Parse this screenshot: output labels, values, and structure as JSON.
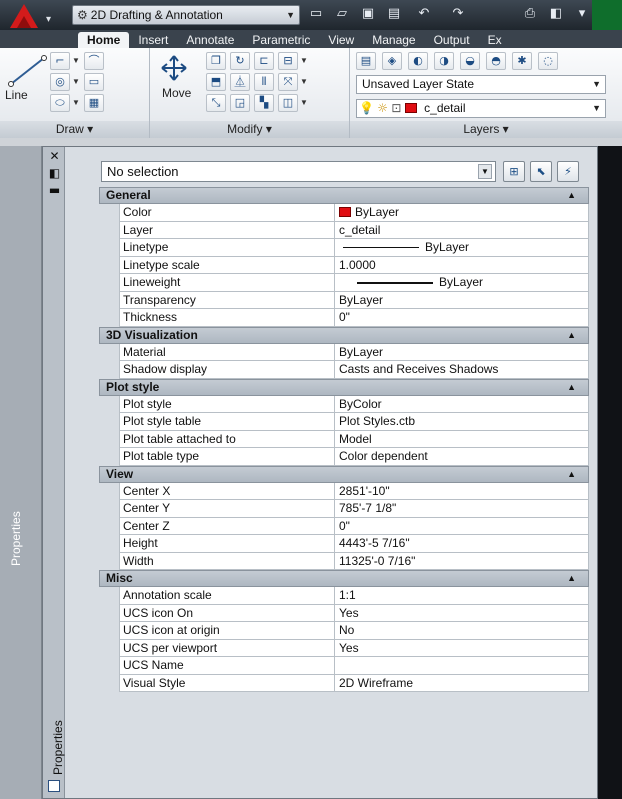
{
  "titlebar": {
    "workspace": "2D Drafting & Annotation",
    "quick_access": [
      "new-icon",
      "open-icon",
      "save-icon",
      "saveas-icon",
      "undo-icon",
      "redo-icon",
      "plot-icon",
      "share-icon"
    ]
  },
  "ribbon": {
    "tabs": [
      "Home",
      "Insert",
      "Annotate",
      "Parametric",
      "View",
      "Manage",
      "Output",
      "Ex"
    ],
    "active_tab": "Home",
    "draw": {
      "title": "Draw ▾",
      "line_label": "Line"
    },
    "modify": {
      "title": "Modify ▾",
      "move_label": "Move"
    },
    "layers": {
      "title": "Layers ▾",
      "layer_state": "Unsaved Layer State",
      "current_layer": "c_detail",
      "layer_color": "#e00d12"
    }
  },
  "palette": {
    "side_title": "Properties",
    "strip_title": "Properties",
    "selection": "No selection",
    "categories": [
      {
        "name": "General",
        "rows": [
          {
            "name": "Color",
            "value": "ByLayer",
            "swatch": "#e00d12"
          },
          {
            "name": "Layer",
            "value": "c_detail"
          },
          {
            "name": "Linetype",
            "value": "ByLayer",
            "line": "thin"
          },
          {
            "name": "Linetype scale",
            "value": "1.0000"
          },
          {
            "name": "Lineweight",
            "value": "ByLayer",
            "line": "thick"
          },
          {
            "name": "Transparency",
            "value": "ByLayer"
          },
          {
            "name": "Thickness",
            "value": "0\""
          }
        ]
      },
      {
        "name": "3D Visualization",
        "rows": [
          {
            "name": "Material",
            "value": "ByLayer"
          },
          {
            "name": "Shadow display",
            "value": "Casts and Receives Shadows"
          }
        ]
      },
      {
        "name": "Plot style",
        "rows": [
          {
            "name": "Plot style",
            "value": "ByColor"
          },
          {
            "name": "Plot style table",
            "value": "Plot Styles.ctb"
          },
          {
            "name": "Plot table attached to",
            "value": "Model"
          },
          {
            "name": "Plot table type",
            "value": "Color dependent"
          }
        ]
      },
      {
        "name": "View",
        "rows": [
          {
            "name": "Center X",
            "value": "2851'-10\""
          },
          {
            "name": "Center Y",
            "value": "785'-7 1/8\""
          },
          {
            "name": "Center Z",
            "value": "0\""
          },
          {
            "name": "Height",
            "value": "4443'-5 7/16\""
          },
          {
            "name": "Width",
            "value": "11325'-0 7/16\""
          }
        ]
      },
      {
        "name": "Misc",
        "rows": [
          {
            "name": "Annotation scale",
            "value": "1:1"
          },
          {
            "name": "UCS icon On",
            "value": "Yes"
          },
          {
            "name": "UCS icon at origin",
            "value": "No"
          },
          {
            "name": "UCS per viewport",
            "value": "Yes"
          },
          {
            "name": "UCS Name",
            "value": ""
          },
          {
            "name": "Visual Style",
            "value": "2D Wireframe"
          }
        ]
      }
    ]
  }
}
